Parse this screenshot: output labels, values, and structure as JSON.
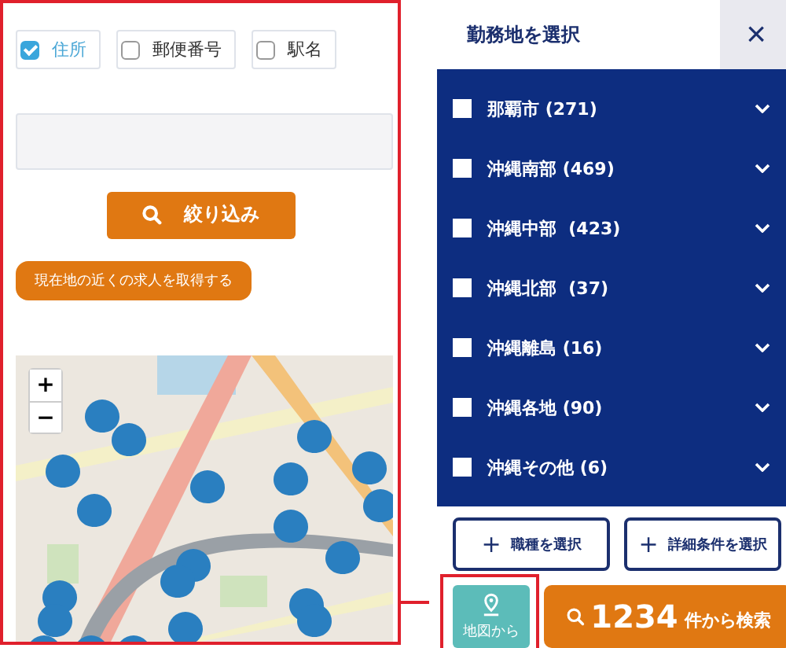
{
  "search_type_options": [
    {
      "label": "住所",
      "checked": true
    },
    {
      "label": "郵便番号",
      "checked": false
    },
    {
      "label": "駅名",
      "checked": false
    }
  ],
  "filter_button": "絞り込み",
  "nearby_button": "現在地の近くの求人を取得する",
  "map": {
    "kind": "picture",
    "zoom_in": "+",
    "zoom_out": "−"
  },
  "panel": {
    "title": "勤務地を選択",
    "close": "×"
  },
  "areas": [
    {
      "label": "那覇市 (271)",
      "checked": false
    },
    {
      "label": "沖縄南部 (469)",
      "checked": false
    },
    {
      "label": "沖縄中部  (423)",
      "checked": false
    },
    {
      "label": "沖縄北部  (37)",
      "checked": false
    },
    {
      "label": "沖縄離島 (16)",
      "checked": false
    },
    {
      "label": "沖縄各地 (90)",
      "checked": false
    },
    {
      "label": "沖縄その他 (6)",
      "checked": false
    }
  ],
  "option_buttons": [
    {
      "icon": "+",
      "label": "職種を選択"
    },
    {
      "icon": "+",
      "label": "詳細条件を選択"
    }
  ],
  "map_button": "地図から",
  "search_button": {
    "count": "1234",
    "label": "件から検索"
  }
}
